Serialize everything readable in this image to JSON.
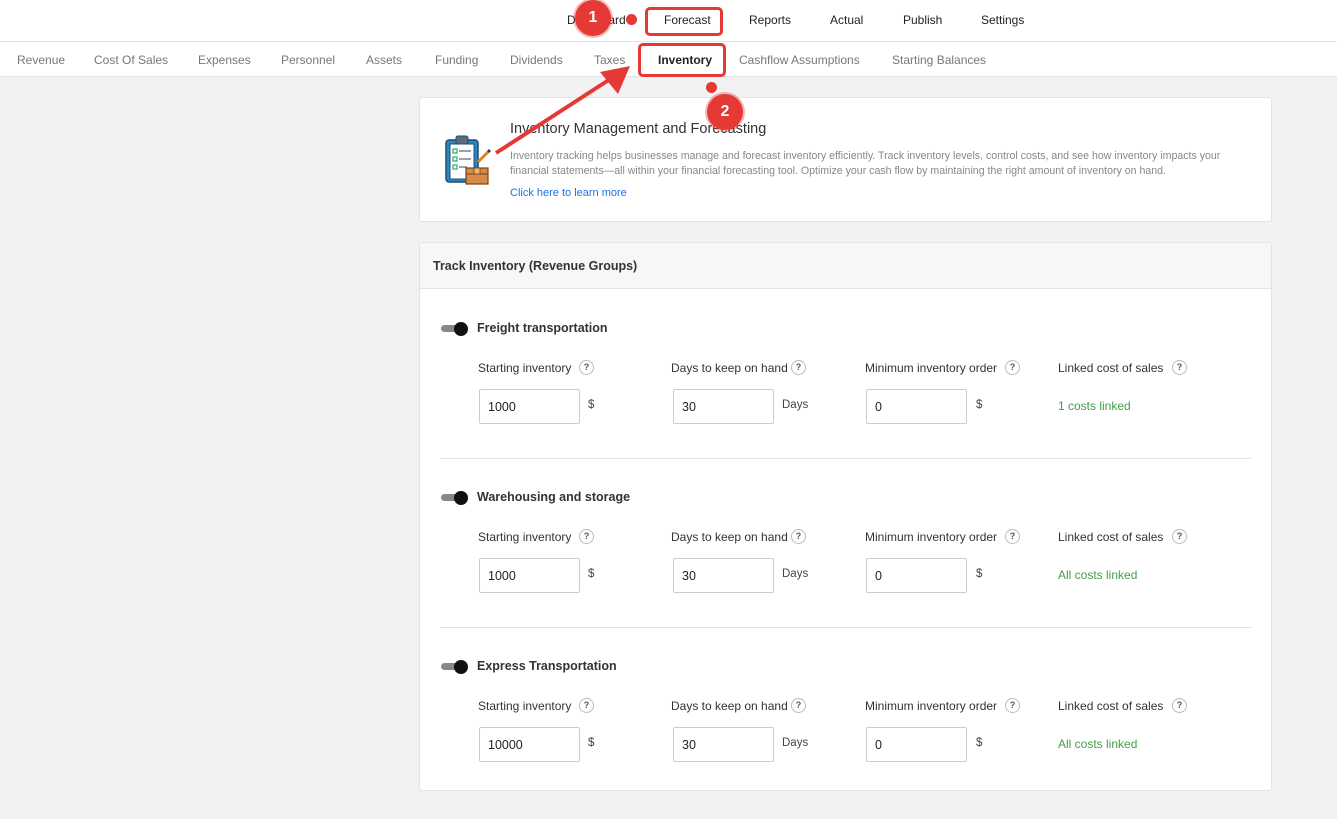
{
  "topnav": {
    "items": [
      {
        "label": "Dashboard"
      },
      {
        "label": "Forecast"
      },
      {
        "label": "Reports"
      },
      {
        "label": "Actual"
      },
      {
        "label": "Publish"
      },
      {
        "label": "Settings"
      }
    ],
    "active": "Forecast"
  },
  "subnav": {
    "items": [
      {
        "label": "Revenue"
      },
      {
        "label": "Cost Of Sales"
      },
      {
        "label": "Expenses"
      },
      {
        "label": "Personnel"
      },
      {
        "label": "Assets"
      },
      {
        "label": "Funding"
      },
      {
        "label": "Dividends"
      },
      {
        "label": "Taxes"
      },
      {
        "label": "Inventory"
      },
      {
        "label": "Cashflow Assumptions"
      },
      {
        "label": "Starting Balances"
      }
    ],
    "active": "Inventory"
  },
  "info": {
    "icon": "clipboard-checklist-icon",
    "title": "Inventory Management and Forecasting",
    "description": "Inventory tracking helps businesses manage and forecast inventory efficiently. Track inventory levels, control costs, and see how inventory impacts your financial statements—all within your financial forecasting tool. Optimize your cash flow by maintaining the right amount of inventory on hand.",
    "link": "Click here to learn more"
  },
  "track": {
    "title": "Track Inventory (Revenue Groups)",
    "labels": {
      "starting_inventory": "Starting inventory",
      "days_on_hand": "Days to keep on hand",
      "min_order": "Minimum inventory order",
      "linked": "Linked cost of sales",
      "help": "?",
      "currency": "$",
      "days": "Days"
    },
    "groups": [
      {
        "name": "Freight transportation",
        "enabled": true,
        "starting_inventory": "1000",
        "days_on_hand": "30",
        "min_order": "0",
        "linked": "1 costs linked"
      },
      {
        "name": "Warehousing and storage",
        "enabled": true,
        "starting_inventory": "1000",
        "days_on_hand": "30",
        "min_order": "0",
        "linked": "All costs linked"
      },
      {
        "name": "Express Transportation",
        "enabled": true,
        "starting_inventory": "10000",
        "days_on_hand": "30",
        "min_order": "0",
        "linked": "All costs linked"
      }
    ]
  },
  "annotations": {
    "step1": "1",
    "step2": "2",
    "color": "#e53935"
  },
  "colors": {
    "link": "#1a73e8",
    "linked_green": "#43a047",
    "accent_red": "#e53935"
  }
}
